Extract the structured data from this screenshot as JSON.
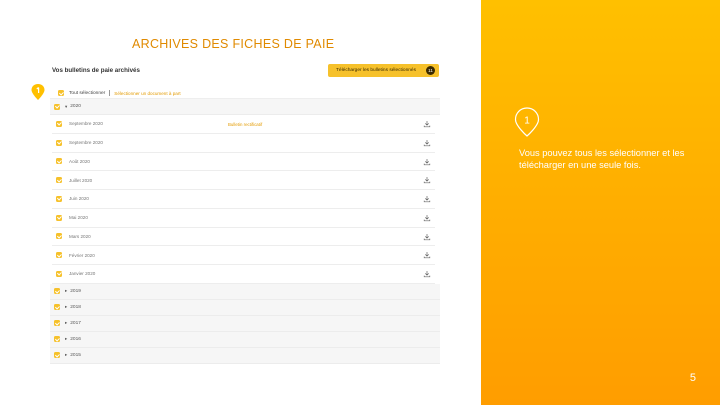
{
  "slide": {
    "title": "ARCHIVES DES FICHES DE PAIE",
    "page_number": "5",
    "accent_color": "#ffad00"
  },
  "app": {
    "title": "Vos bulletins de paie archivés",
    "download_selected_label": "Télécharger les bulletins sélectionnés",
    "download_selected_count": "11",
    "select_all_label": "Tout sélectionner",
    "select_document_link": "Sélectionner un document à part",
    "years": [
      {
        "label": "2020",
        "expanded": true,
        "checked": true
      },
      {
        "label": "2019",
        "expanded": false,
        "checked": true
      },
      {
        "label": "2018",
        "expanded": false,
        "checked": true
      },
      {
        "label": "2017",
        "expanded": false,
        "checked": true
      },
      {
        "label": "2016",
        "expanded": false,
        "checked": true
      },
      {
        "label": "2015",
        "expanded": false,
        "checked": true
      }
    ],
    "months_2020": [
      {
        "label": "Septembre 2020",
        "note": "Bulletin rectificatif"
      },
      {
        "label": "Septembre 2020",
        "note": ""
      },
      {
        "label": "Août 2020",
        "note": ""
      },
      {
        "label": "Juillet 2020",
        "note": ""
      },
      {
        "label": "Juin 2020",
        "note": ""
      },
      {
        "label": "Mai 2020",
        "note": ""
      },
      {
        "label": "Mars 2020",
        "note": ""
      },
      {
        "label": "Février 2020",
        "note": ""
      },
      {
        "label": "Janvier 2020",
        "note": ""
      }
    ],
    "icons": {
      "checkbox": "checkbox-checked-icon",
      "download": "download-icon",
      "caret": "caret-icon"
    }
  },
  "callout": {
    "number": "1",
    "text": "Vous pouvez tous les sélectionner et les télécharger en une seule fois."
  }
}
